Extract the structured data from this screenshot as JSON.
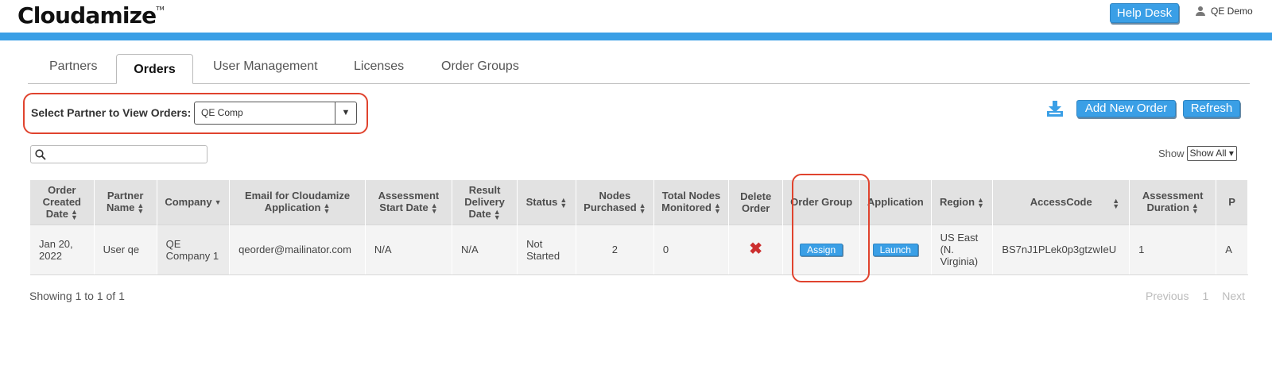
{
  "header": {
    "logo_text": "Cloudamize",
    "logo_tm": "TM",
    "help_desk": "Help Desk",
    "user": "QE Demo"
  },
  "tabs": [
    {
      "label": "Partners",
      "active": false
    },
    {
      "label": "Orders",
      "active": true
    },
    {
      "label": "User Management",
      "active": false
    },
    {
      "label": "Licenses",
      "active": false
    },
    {
      "label": "Order Groups",
      "active": false
    }
  ],
  "filter": {
    "label": "Select Partner to View Orders:",
    "selected": "QE Comp",
    "arrow": "▼"
  },
  "toolbar": {
    "add_new_order": "Add New Order",
    "refresh": "Refresh",
    "download_icon": "download-icon"
  },
  "search": {
    "value": "",
    "icon": "search-icon"
  },
  "show": {
    "label": "Show",
    "selected": "Show All"
  },
  "table": {
    "columns": [
      {
        "label": "Order Created Date",
        "sort": "both"
      },
      {
        "label": "Partner Name",
        "sort": "both"
      },
      {
        "label": "Company",
        "sort": "desc"
      },
      {
        "label": "Email for Cloudamize Application",
        "sort": "both"
      },
      {
        "label": "Assessment Start Date",
        "sort": "both"
      },
      {
        "label": "Result Delivery Date",
        "sort": "both"
      },
      {
        "label": "Status",
        "sort": "both"
      },
      {
        "label": "Nodes Purchased",
        "sort": "both"
      },
      {
        "label": "Total Nodes Monitored",
        "sort": "both"
      },
      {
        "label": "Delete Order",
        "sort": "none"
      },
      {
        "label": "Order Group",
        "sort": "none"
      },
      {
        "label": "Application",
        "sort": "none"
      },
      {
        "label": "Region",
        "sort": "both"
      },
      {
        "label": "AccessCode",
        "sort": "both"
      },
      {
        "label": "Assessment Duration",
        "sort": "both"
      },
      {
        "label": "P",
        "sort": "none"
      }
    ],
    "rows": [
      {
        "order_created_date": "Jan 20, 2022",
        "partner_name": "User qe",
        "company": "QE Company 1",
        "email": "qeorder@mailinator.com",
        "assessment_start_date": "N/A",
        "result_delivery_date": "N/A",
        "status": "Not Started",
        "nodes_purchased": "2",
        "total_nodes_monitored": "0",
        "delete_icon": "delete-icon",
        "order_group_button": "Assign",
        "application_button": "Launch",
        "region": "US East (N. Virginia)",
        "access_code": "BS7nJ1PLek0p3gtzwIeU",
        "assessment_duration": "1",
        "p": "A"
      }
    ]
  },
  "footer": {
    "info": "Showing 1 to 1 of 1",
    "previous": "Previous",
    "page": "1",
    "next": "Next"
  },
  "colors": {
    "accent": "#3a9fe6",
    "highlight": "#e0432e",
    "delete": "#cc2e2e"
  }
}
